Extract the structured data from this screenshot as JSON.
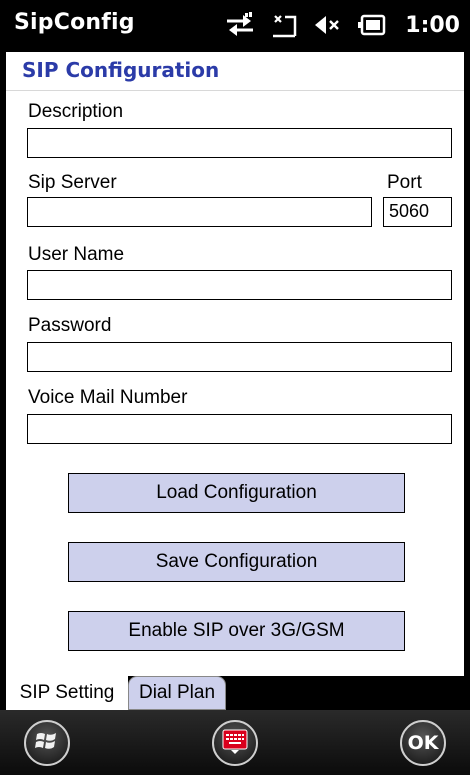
{
  "status_bar": {
    "app_title": "SipConfig",
    "time": "1:00",
    "icons": [
      "connection-arrows-icon",
      "signal-off-icon",
      "speaker-muted-icon",
      "battery-icon"
    ]
  },
  "header": {
    "title": "SIP Configuration"
  },
  "form": {
    "description_label": "Description",
    "description_value": "",
    "sip_server_label": "Sip Server",
    "sip_server_value": "",
    "port_label": "Port",
    "port_value": "5060",
    "user_name_label": "User Name",
    "user_name_value": "",
    "password_label": "Password",
    "password_value": "",
    "voice_mail_label": "Voice Mail Number",
    "voice_mail_value": ""
  },
  "buttons": {
    "load": "Load Configuration",
    "save": "Save Configuration",
    "enable_sip": "Enable SIP over 3G/GSM"
  },
  "tabs": [
    {
      "label": "SIP Setting",
      "active": true
    },
    {
      "label": "Dial Plan",
      "active": false
    }
  ],
  "taskbar": {
    "ok_label": "OK"
  },
  "colors": {
    "header_text": "#2b3ba8",
    "button_bg": "#cdd0ec",
    "keyboard_red": "#d9001c"
  }
}
